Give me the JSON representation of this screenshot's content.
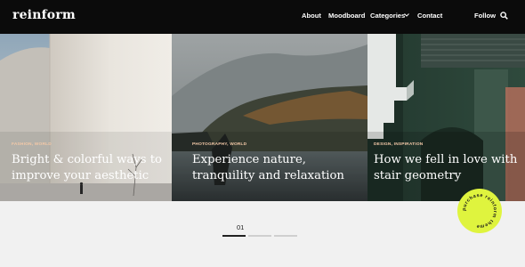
{
  "header": {
    "logo": "reinform",
    "nav": [
      "About",
      "Moodboard",
      "Categories",
      "Contact"
    ],
    "follow": "Follow"
  },
  "slides": [
    {
      "category": "FASHION, WORLD",
      "title_lines": [
        "Bright & colorful ways to",
        "improve your aesthetic"
      ]
    },
    {
      "category": "PHOTOGRAPHY, WORLD",
      "title_lines": [
        "Experience nature,",
        "tranquility and relaxation"
      ]
    },
    {
      "category": "DESIGN, INSPIRATION",
      "title_lines": [
        "How we fell in love with",
        "stair geometry"
      ]
    }
  ],
  "pager": {
    "current": "01",
    "total_pages": 3,
    "active_index": 0
  },
  "badge": {
    "text": "purchase reinform theme"
  },
  "colors": {
    "header_bg": "#0b0b0b",
    "category": "#f4c9a8",
    "badge": "#dff43e"
  }
}
